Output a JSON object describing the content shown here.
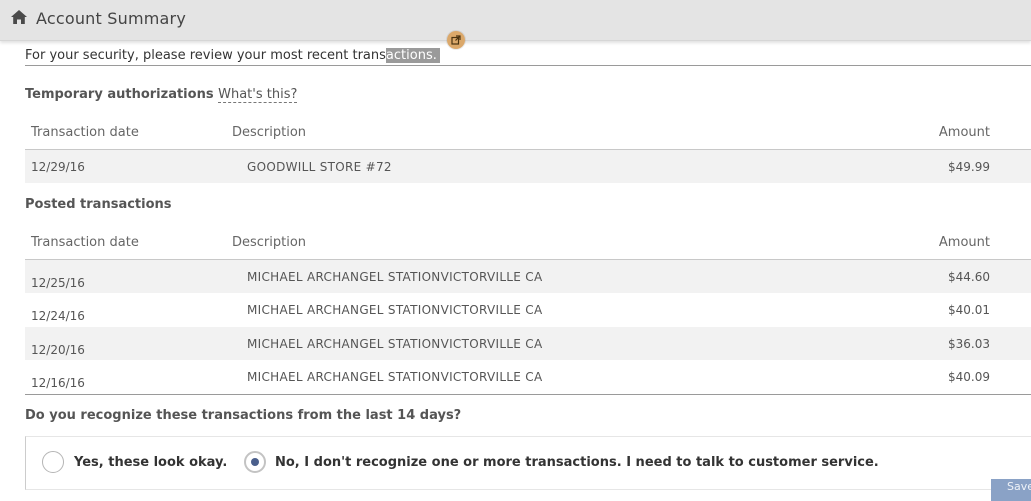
{
  "header": {
    "title": "Account Summary",
    "home_icon": "home-icon"
  },
  "popout_icon": "external-link-icon",
  "security": {
    "text_before": "For your security, please review your most recent trans",
    "text_highlighted": "actions."
  },
  "temporary": {
    "title": "Temporary authorizations",
    "help_link": "What's this?",
    "columns": {
      "date": "Transaction date",
      "description": "Description",
      "amount": "Amount"
    },
    "rows": [
      {
        "date": "12/29/16",
        "description": "GOODWILL STORE #72",
        "amount": "$49.99"
      }
    ]
  },
  "posted": {
    "title": "Posted transactions",
    "columns": {
      "date": "Transaction date",
      "description": "Description",
      "amount": "Amount"
    },
    "rows": [
      {
        "date": "12/25/16",
        "description": "MICHAEL ARCHANGEL STATIONVICTORVILLE CA",
        "amount": "$44.60"
      },
      {
        "date": "12/24/16",
        "description": "MICHAEL ARCHANGEL STATIONVICTORVILLE CA",
        "amount": "$40.01"
      },
      {
        "date": "12/20/16",
        "description": "MICHAEL ARCHANGEL STATIONVICTORVILLE CA",
        "amount": "$36.03"
      },
      {
        "date": "12/16/16",
        "description": "MICHAEL ARCHANGEL STATIONVICTORVILLE CA",
        "amount": "$40.09"
      }
    ]
  },
  "question": "Do you recognize these transactions from the last 14 days?",
  "options": [
    {
      "label": "Yes, these look okay.",
      "selected": false
    },
    {
      "label": "No, I don't recognize one or more transactions.  I need to talk to customer service.",
      "selected": true
    }
  ],
  "save_label": "Save",
  "colors": {
    "header_bg": "#e4e4e4",
    "row_alt_bg": "#f2f2f2",
    "radio_dot": "#4a5f8c",
    "save_button_bg": "#8aa2c6",
    "popout_badge": "#dba86a"
  }
}
